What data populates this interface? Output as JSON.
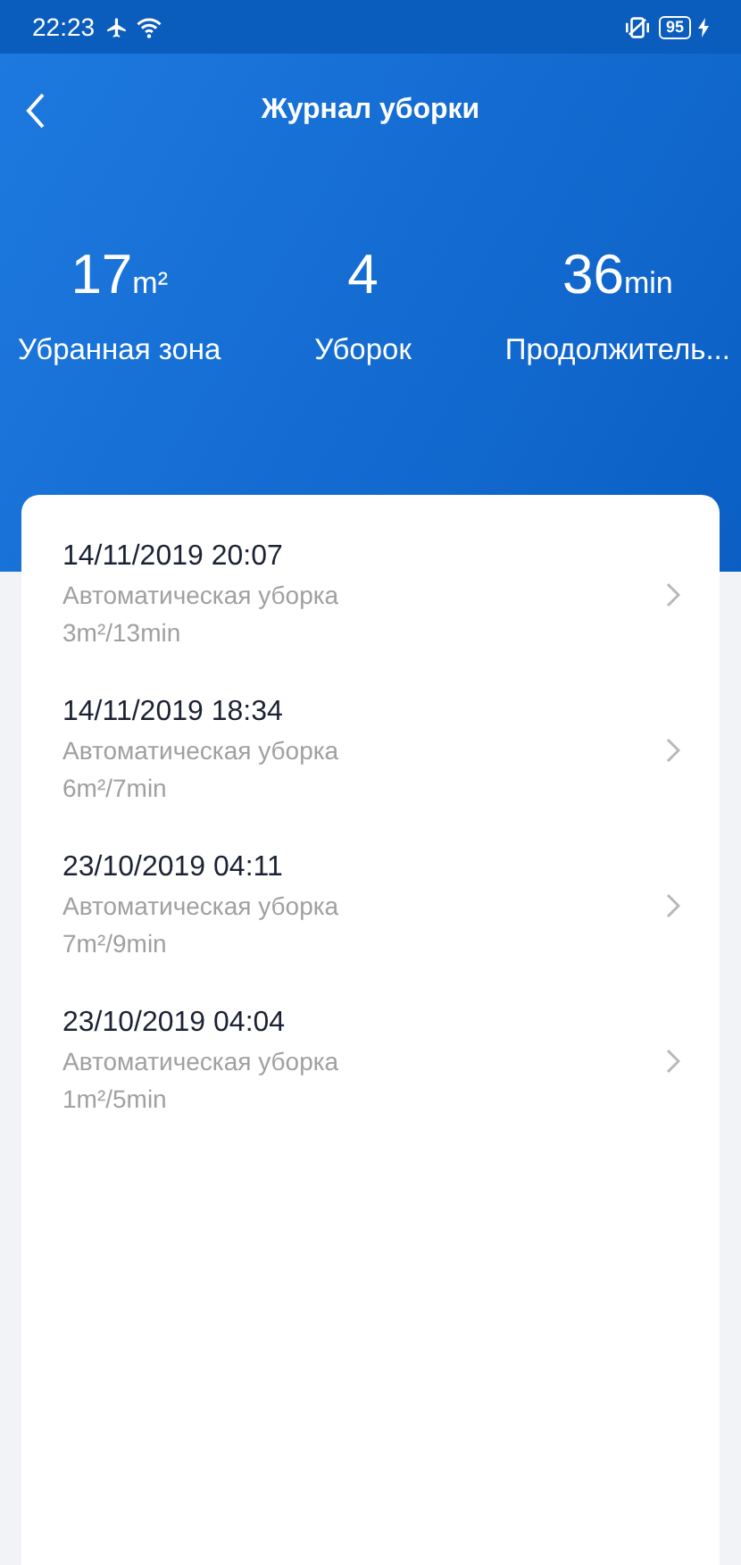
{
  "status_bar": {
    "time": "22:23",
    "battery": "95"
  },
  "header": {
    "title": "Журнал уборки"
  },
  "stats": [
    {
      "value": "17",
      "unit": "m²",
      "label": "Убранная зона"
    },
    {
      "value": "4",
      "label": "Уборок"
    },
    {
      "value": "36",
      "unit": "min",
      "label": "Продолжитель..."
    }
  ],
  "records": [
    {
      "datetime": "14/11/2019 20:07",
      "mode": "Автоматическая уборка",
      "summary": "3m²/13min"
    },
    {
      "datetime": "14/11/2019 18:34",
      "mode": "Автоматическая уборка",
      "summary": "6m²/7min"
    },
    {
      "datetime": "23/10/2019 04:11",
      "mode": "Автоматическая уборка",
      "summary": "7m²/9min"
    },
    {
      "datetime": "23/10/2019 04:04",
      "mode": "Автоматическая уборка",
      "summary": "1m²/5min"
    }
  ]
}
